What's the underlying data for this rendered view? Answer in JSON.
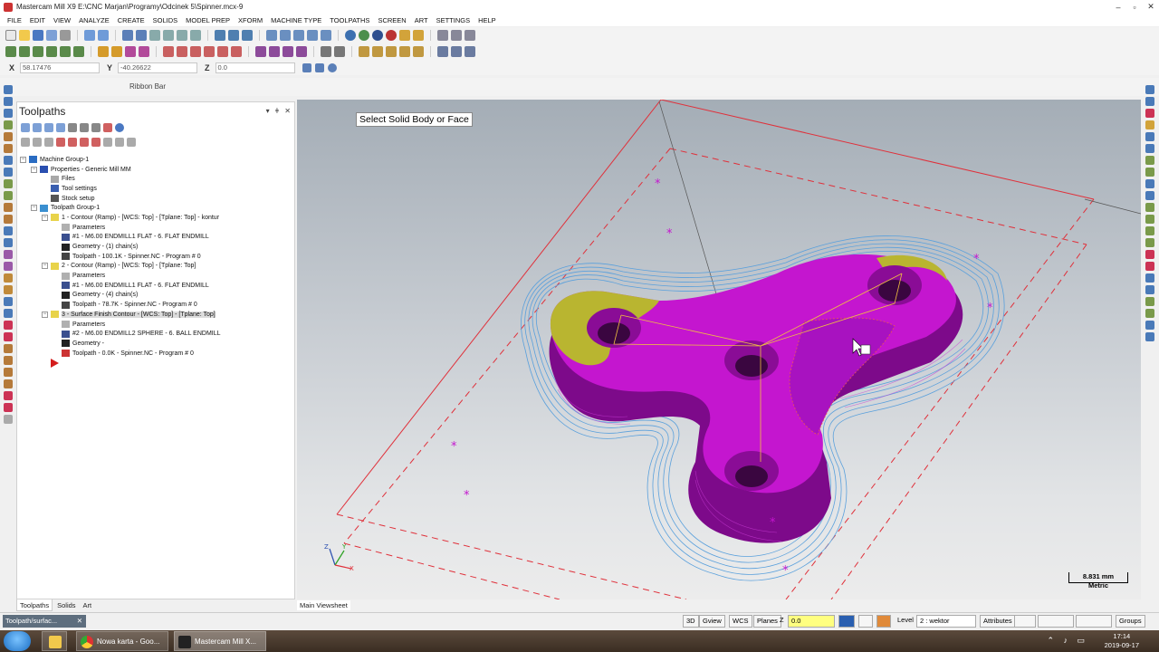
{
  "window": {
    "title": "Mastercam Mill X9  E:\\CNC Marjan\\Programy\\Odcinek 5\\Spinner.mcx-9",
    "minimize": "–",
    "restore": "▫",
    "close": "✕"
  },
  "menu": [
    "FILE",
    "EDIT",
    "VIEW",
    "ANALYZE",
    "CREATE",
    "SOLIDS",
    "MODEL PREP",
    "XFORM",
    "MACHINE TYPE",
    "TOOLPATHS",
    "SCREEN",
    "ART",
    "SETTINGS",
    "HELP"
  ],
  "coords": {
    "x_label": "X",
    "x_value": "58.17476",
    "y_label": "Y",
    "y_value": "-40.26622",
    "z_label": "Z",
    "z_value": "0.0"
  },
  "ribbon_bar_label": "Ribbon Bar",
  "panel": {
    "title": "Toolpaths",
    "pin": "▾",
    "auto_hide": "ǂ",
    "close": "✕",
    "tree": [
      {
        "label": "Machine Group-1",
        "level": 0,
        "icon": "machine-group-icon",
        "exp": "−"
      },
      {
        "label": "Properties - Generic Mill MM",
        "level": 1,
        "icon": "properties-icon",
        "exp": "−"
      },
      {
        "label": "Files",
        "level": 2,
        "icon": "folder-icon"
      },
      {
        "label": "Tool settings",
        "level": 2,
        "icon": "tool-settings-icon"
      },
      {
        "label": "Stock setup",
        "level": 2,
        "icon": "stock-setup-icon"
      },
      {
        "label": "Toolpath Group-1",
        "level": 1,
        "icon": "toolpath-group-icon",
        "exp": "−"
      },
      {
        "label": "1 - Contour (Ramp) - [WCS: Top] - [Tplane: Top] - kontur",
        "level": 2,
        "icon": "operation-folder-icon",
        "exp": "−"
      },
      {
        "label": "Parameters",
        "level": 3,
        "icon": "parameters-icon"
      },
      {
        "label": "#1 - M6.00 ENDMILL1 FLAT - 6. FLAT ENDMILL",
        "level": 3,
        "icon": "tool-icon"
      },
      {
        "label": "Geometry - (1) chain(s)",
        "level": 3,
        "icon": "geometry-icon"
      },
      {
        "label": "Toolpath - 100.1K - Spinner.NC - Program # 0",
        "level": 3,
        "icon": "toolpath-icon"
      },
      {
        "label": "2 - Contour (Ramp) - [WCS: Top] - [Tplane: Top]",
        "level": 2,
        "icon": "operation-folder-icon",
        "exp": "−"
      },
      {
        "label": "Parameters",
        "level": 3,
        "icon": "parameters-icon"
      },
      {
        "label": "#1 - M6.00 ENDMILL1 FLAT - 6. FLAT ENDMILL",
        "level": 3,
        "icon": "tool-icon"
      },
      {
        "label": "Geometry - (4) chain(s)",
        "level": 3,
        "icon": "geometry-icon"
      },
      {
        "label": "Toolpath - 78.7K - Spinner.NC - Program # 0",
        "level": 3,
        "icon": "toolpath-icon"
      },
      {
        "label": "3 - Surface Finish Contour - [WCS: Top] - [Tplane: Top]",
        "level": 2,
        "icon": "operation-folder-icon",
        "exp": "−",
        "selected": true
      },
      {
        "label": "Parameters",
        "level": 3,
        "icon": "parameters-icon"
      },
      {
        "label": "#2 - M6.00 ENDMILL2 SPHERE - 6. BALL ENDMILL",
        "level": 3,
        "icon": "tool-icon"
      },
      {
        "label": "Geometry -",
        "level": 3,
        "icon": "geometry-icon"
      },
      {
        "label": "Toolpath - 0.0K - Spinner.NC - Program # 0",
        "level": 3,
        "icon": "toolpath-dirty-icon"
      },
      {
        "label": "",
        "level": 2,
        "icon": "insert-arrow-icon"
      }
    ],
    "tabs": [
      "Toolpaths",
      "Solids",
      "Art"
    ]
  },
  "viewport": {
    "prompt": "Select Solid Body or Face",
    "scale_value": "8.831 mm",
    "scale_units": "Metric",
    "tab": "Main Viewsheet",
    "axis_x": "X",
    "axis_y": "Y",
    "axis_z": "Z"
  },
  "statusbar": {
    "pill": "Toolpath/surfac...",
    "pill_close": "✕",
    "b3d": "3D",
    "gview": "Gview",
    "wcs": "WCS",
    "planes": "Planes",
    "z": "Z",
    "z_value": "0.0",
    "level_label": "Level",
    "level_value": "2 : wektor",
    "attributes": "Attributes",
    "groups": "Groups"
  },
  "taskbar": {
    "chrome": "Nowa karta - Goo...",
    "mastercam": "Mastercam Mill X...",
    "time": "17:14",
    "date": "2019-09-17"
  },
  "colors": {
    "solid": "#c416cf",
    "solid_dark": "#7d0a8a",
    "highlight": "#b9b530",
    "toolpath": "#5aa0dc",
    "boundary": "#e0303a"
  }
}
